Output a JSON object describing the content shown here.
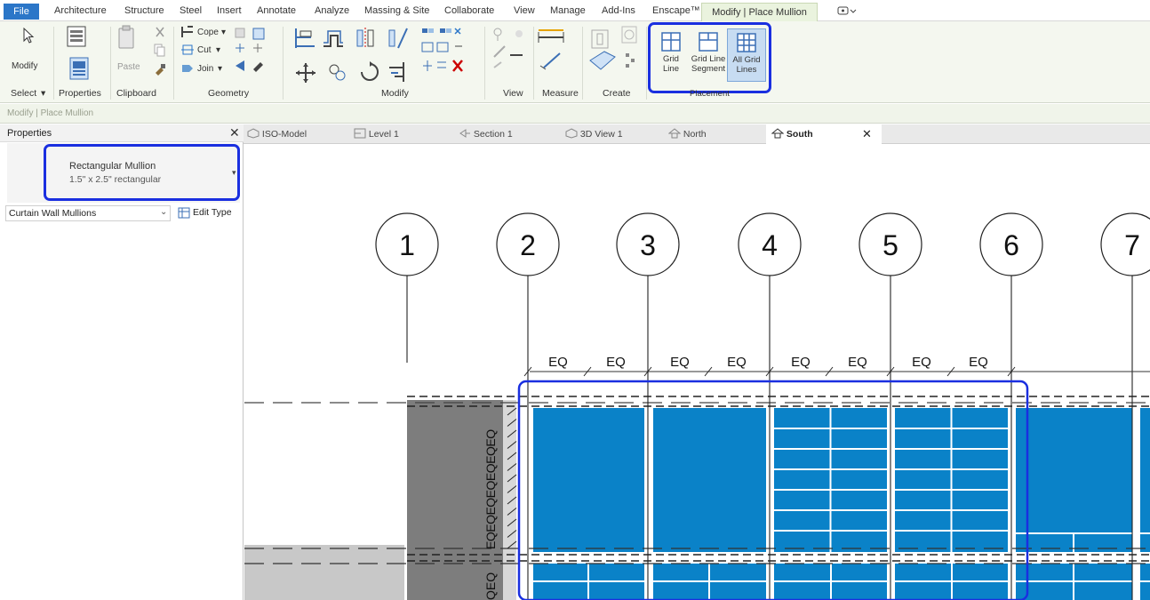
{
  "menu": {
    "file": "File",
    "tabs": [
      "Architecture",
      "Structure",
      "Steel",
      "Insert",
      "Annotate",
      "Analyze",
      "Massing & Site",
      "Collaborate",
      "View",
      "Manage",
      "Add-Ins",
      "Enscape™"
    ],
    "context_tab": "Modify | Place Mullion"
  },
  "ribbon": {
    "modify_label": "Modify",
    "paste_label": "Paste",
    "cope": "Cope",
    "cut": "Cut",
    "join": "Join",
    "panels": [
      "Select",
      "Properties",
      "Clipboard",
      "Geometry",
      "Modify",
      "View",
      "Measure",
      "Create",
      "Placement"
    ],
    "placement_tools": [
      {
        "l1": "Grid",
        "l2": "Line"
      },
      {
        "l1": "Grid Line",
        "l2": "Segment"
      },
      {
        "l1": "All Grid",
        "l2": "Lines"
      }
    ]
  },
  "context_bar": "Modify | Place Mullion",
  "properties": {
    "title": "Properties",
    "type_name": "Rectangular Mullion",
    "type_size": "1.5\" x 2.5\" rectangular",
    "category": "Curtain Wall Mullions",
    "edit_type": "Edit Type"
  },
  "view_tabs": [
    "ISO-Model",
    "Level 1",
    "Section 1",
    "3D View 1",
    "North",
    "South"
  ],
  "active_view": "South",
  "grids": [
    "1",
    "2",
    "3",
    "4",
    "5",
    "6",
    "7"
  ],
  "dims": {
    "eq": "EQ",
    "vertical_text": "EQEQEQEQEQEQEQ",
    "vertical_text2": "QEQ"
  },
  "colors": {
    "panel": "#0a82c8",
    "highlight": "#1a2fe0",
    "file_tab": "#2b76c8"
  }
}
